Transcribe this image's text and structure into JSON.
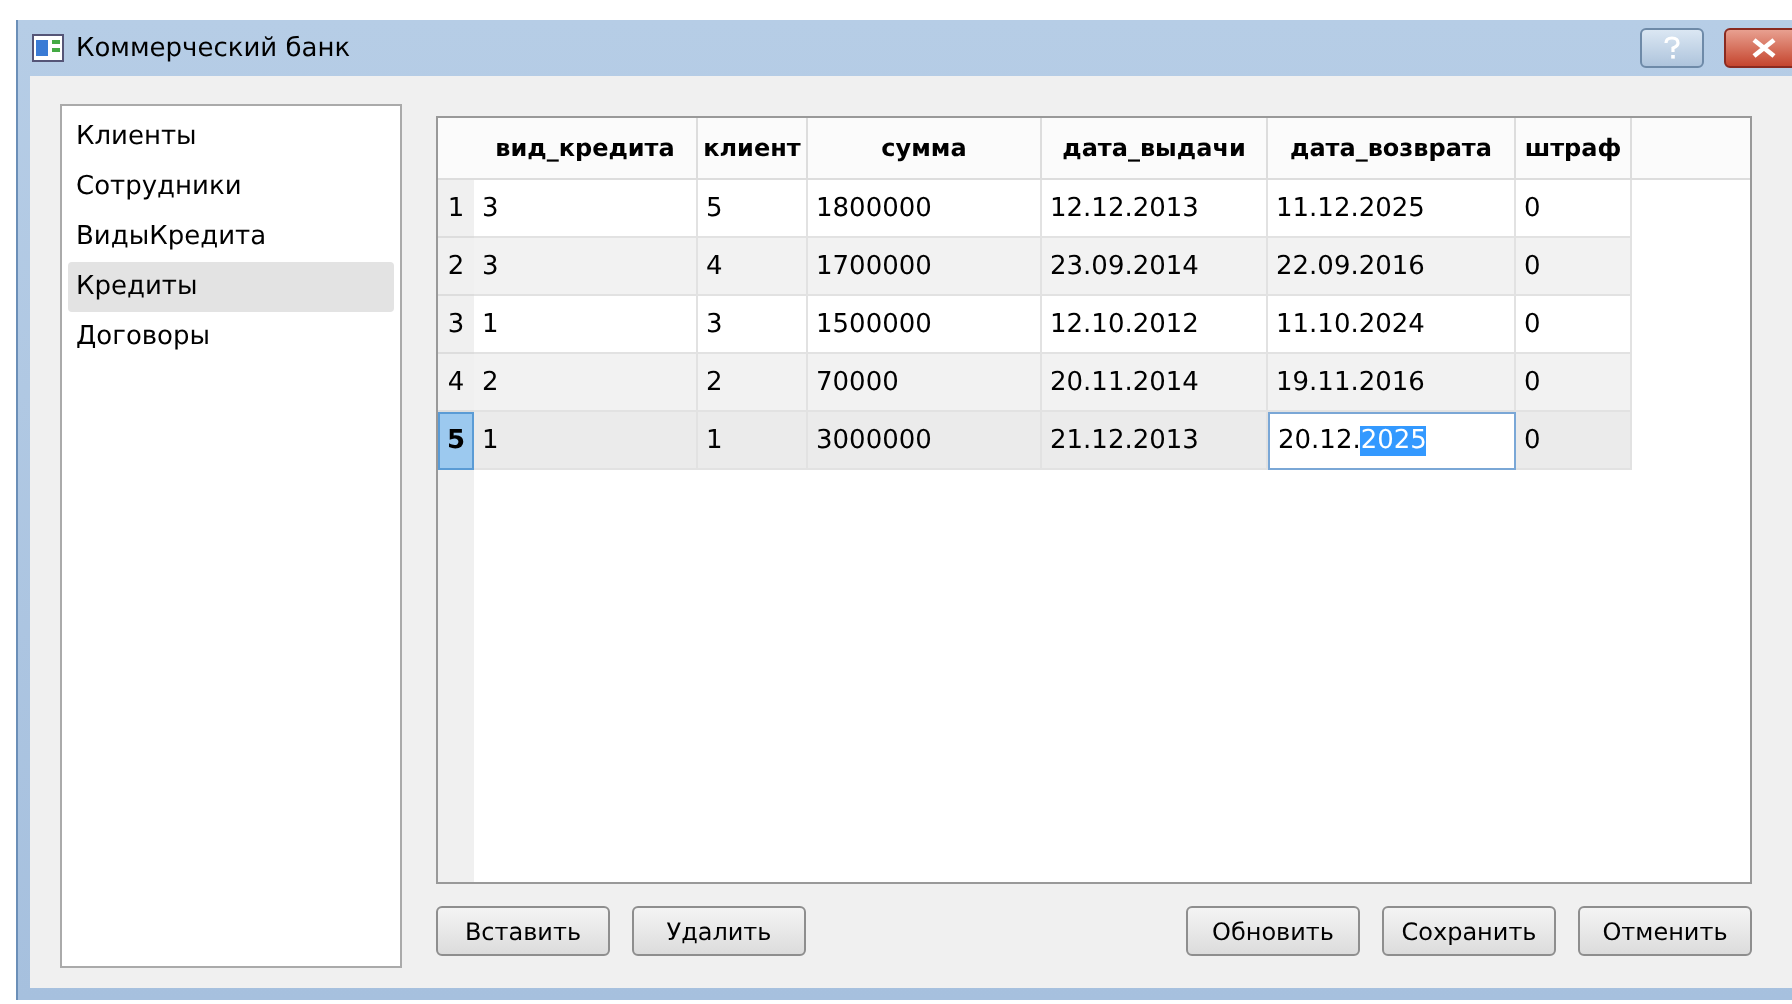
{
  "window": {
    "title": "Коммерческий банк"
  },
  "sidebar": {
    "items": [
      {
        "label": "Клиенты",
        "selected": false
      },
      {
        "label": "Сотрудники",
        "selected": false
      },
      {
        "label": "ВидыКредита",
        "selected": false
      },
      {
        "label": "Кредиты",
        "selected": true
      },
      {
        "label": "Договоры",
        "selected": false
      }
    ]
  },
  "table": {
    "columns": [
      "вид_кредита",
      "клиент",
      "сумма",
      "дата_выдачи",
      "дата_возврата",
      "штраф"
    ],
    "rows": [
      {
        "number": "1",
        "selected": false,
        "cells": [
          "3",
          "5",
          "1800000",
          "12.12.2013",
          "11.12.2025",
          "0"
        ]
      },
      {
        "number": "2",
        "selected": false,
        "cells": [
          "3",
          "4",
          "1700000",
          "23.09.2014",
          "22.09.2016",
          "0"
        ]
      },
      {
        "number": "3",
        "selected": false,
        "cells": [
          "1",
          "3",
          "1500000",
          "12.10.2012",
          "11.10.2024",
          "0"
        ]
      },
      {
        "number": "4",
        "selected": false,
        "cells": [
          "2",
          "2",
          "70000",
          "20.11.2014",
          "19.11.2016",
          "0"
        ]
      },
      {
        "number": "5",
        "selected": true,
        "cells": [
          "1",
          "1",
          "3000000",
          "21.12.2013",
          {
            "text": "20.12.",
            "selected_text": "2025"
          },
          "0"
        ]
      }
    ]
  },
  "buttons_left": [
    "Вставить",
    "Удалить"
  ],
  "buttons_right": [
    "Обновить",
    "Сохранить",
    "Отменить"
  ]
}
